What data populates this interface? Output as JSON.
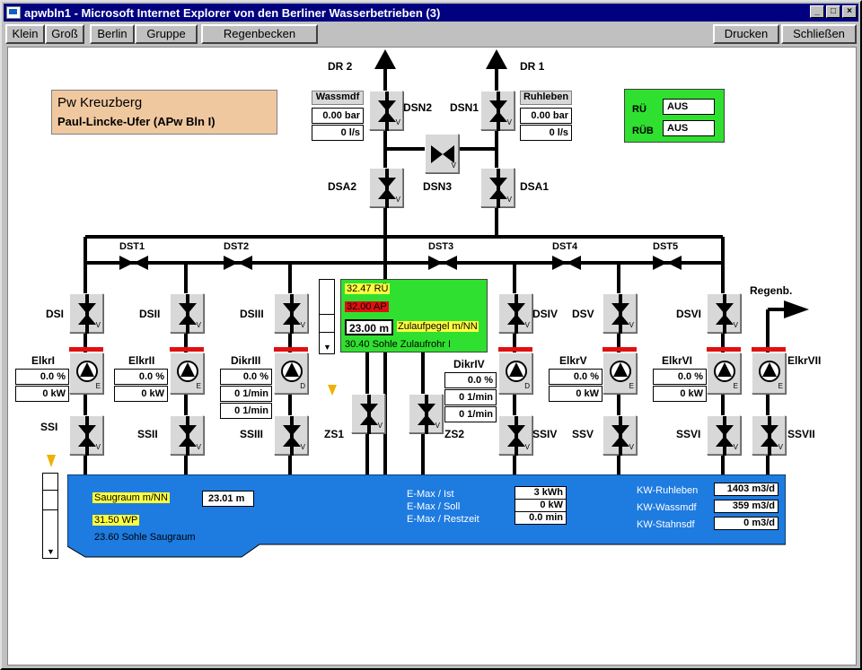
{
  "window": {
    "title": "apwbln1 - Microsoft Internet Explorer von den Berliner Wasserbetrieben (3)",
    "min": "_",
    "max": "□",
    "close": "×"
  },
  "toolbar": {
    "klein": "Klein",
    "gross": "Groß",
    "berlin": "Berlin",
    "gruppe": "Gruppe",
    "regenbecken": "Regenbecken",
    "drucken": "Drucken",
    "schliessen": "Schließen"
  },
  "station": {
    "name": "Pw Kreuzberg",
    "address": "Paul-Lincke-Ufer (APw Bln I)"
  },
  "status": {
    "ru_label": "RÜ",
    "ru_value": "AUS",
    "rub_label": "RÜB",
    "rub_value": "AUS"
  },
  "outlets": {
    "dr2": "DR 2",
    "dr1": "DR 1",
    "regenb": "Regenb."
  },
  "pressure": {
    "wassmdf": "Wassmdf",
    "wassmdf_bar": "0.00 bar",
    "wassmdf_ls": "0 l/s",
    "ruhleben": "Ruhleben",
    "ruhleben_bar": "0.00 bar",
    "ruhleben_ls": "0 l/s"
  },
  "valves": {
    "dsn2": "DSN2",
    "dsn1": "DSN1",
    "dsn3": "DSN3",
    "dsa2": "DSA2",
    "dsa1": "DSA1",
    "dst1": "DST1",
    "dst2": "DST2",
    "dst3": "DST3",
    "dst4": "DST4",
    "dst5": "DST5",
    "dsi": "DSI",
    "dsii": "DSII",
    "dsiii": "DSIII",
    "dsiv": "DSIV",
    "dsv": "DSV",
    "dsvi": "DSVI",
    "ssi": "SSI",
    "ssii": "SSII",
    "ssiii": "SSIII",
    "ssiv": "SSIV",
    "ssv": "SSV",
    "ssvi": "SSVI",
    "ssvii": "SSVII",
    "zs1": "ZS1",
    "zs2": "ZS2",
    "v": "V",
    "e": "E",
    "d": "D"
  },
  "pumps": {
    "elkri": {
      "name": "ElkrI",
      "pct": "0.0 %",
      "kw": "0 kW"
    },
    "elkrii": {
      "name": "ElkrII",
      "pct": "0.0 %",
      "kw": "0 kW"
    },
    "dikriii": {
      "name": "DikrIII",
      "pct": "0.0 %",
      "min1": "0 1/min",
      "min2": "0 1/min"
    },
    "dikriv": {
      "name": "DikrIV",
      "pct": "0.0 %",
      "min1": "0 1/min",
      "min2": "0 1/min"
    },
    "elkrv": {
      "name": "ElkrV",
      "pct": "0.0 %",
      "kw": "0 kW"
    },
    "elkrvi": {
      "name": "ElkrVI",
      "pct": "0.0 %",
      "kw": "0 kW"
    },
    "elkrvii": {
      "name": "ElkrVII"
    }
  },
  "zulauf": {
    "ru": "32.47 RÜ",
    "ap": "32.00 AP",
    "pegel_value": "23.00 m",
    "pegel_label": "Zulaufpegel m/NN",
    "sohle": "30.40 Sohle Zulaufrohr I"
  },
  "saugraum": {
    "label": "Saugraum  m/NN",
    "value": "23.01 m",
    "wp": "31.50 WP",
    "sohle": "23.60 Sohle Saugraum"
  },
  "energy": {
    "ist_label": "E-Max / Ist",
    "ist_value": "3 kWh",
    "soll_label": "E-Max / Soll",
    "soll_value": "0 kW",
    "rest_label": "E-Max / Restzeit",
    "rest_value": "0.0 min"
  },
  "kw": {
    "ruhleben_label": "KW-Ruhleben",
    "ruhleben_value": "1403 m3/d",
    "wassmdf_label": "KW-Wassmdf",
    "wassmdf_value": "359 m3/d",
    "stahnsdf_label": "KW-Stahnsdf",
    "stahnsdf_value": "0 m3/d"
  },
  "colors": {
    "green": "#30e030",
    "blue": "#1e7be0",
    "red": "#e01010",
    "peach": "#f0c8a0",
    "yellow": "#ffff40"
  }
}
